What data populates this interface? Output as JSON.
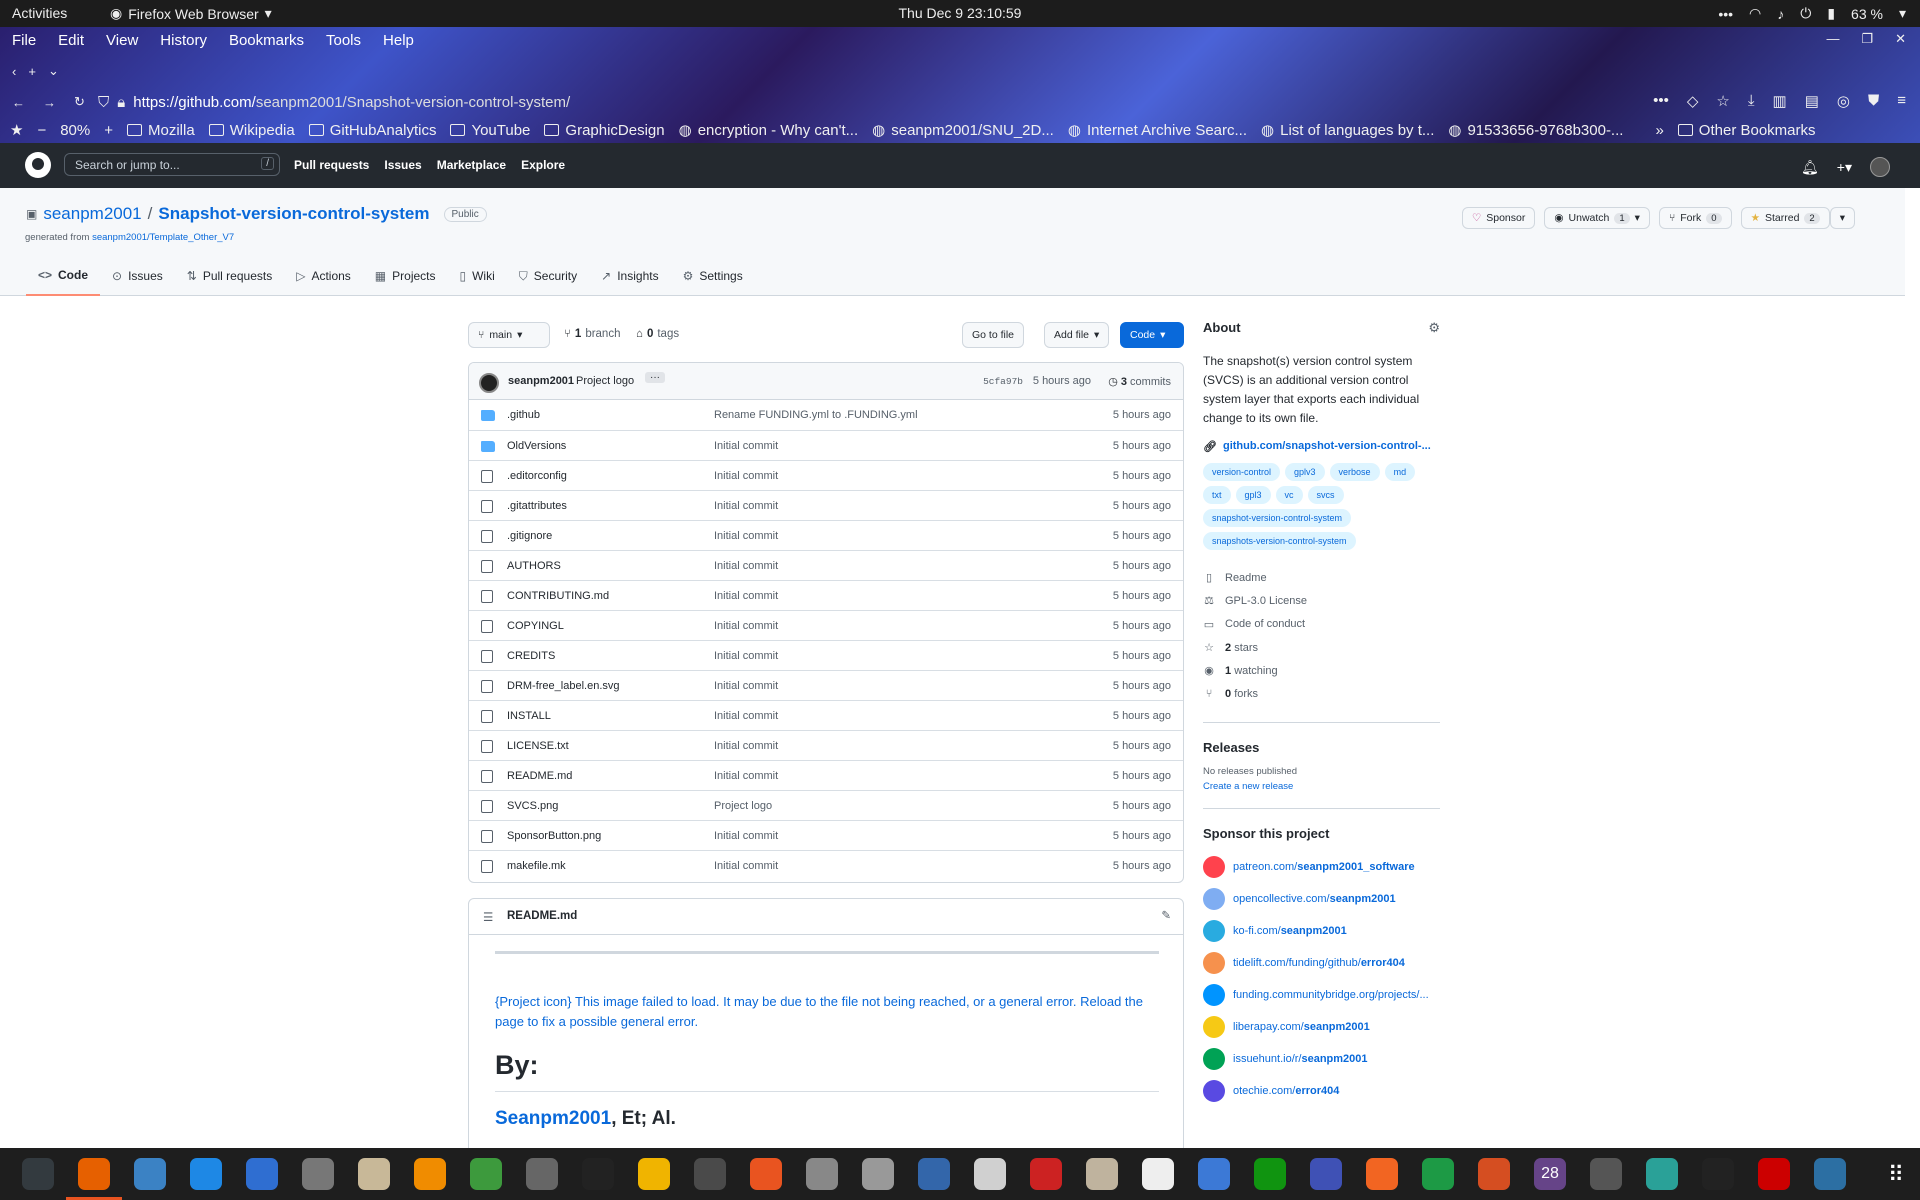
{
  "system": {
    "activities": "Activities",
    "app_name": "Firefox Web Browser",
    "clock": "Thu Dec 9  23:10:59",
    "battery": "63 %"
  },
  "browser": {
    "menu": [
      "File",
      "Edit",
      "View",
      "History",
      "Bookmarks",
      "Tools",
      "Help"
    ],
    "url_host": "https://github.com/",
    "url_path": "seanpm2001/Snapshot-version-control-system/",
    "zoom": "80%",
    "bookmarks": [
      {
        "label": "Mozilla",
        "icon": "folder-icon"
      },
      {
        "label": "Wikipedia",
        "icon": "folder-icon"
      },
      {
        "label": "GitHubAnalytics",
        "icon": "folder-icon"
      },
      {
        "label": "YouTube",
        "icon": "folder-icon"
      },
      {
        "label": "GraphicDesign",
        "icon": "folder-icon"
      },
      {
        "label": "encryption - Why can't...",
        "icon": "stackexchange-icon"
      },
      {
        "label": "seanpm2001/SNU_2D...",
        "icon": "github-icon"
      },
      {
        "label": "Internet Archive Searc...",
        "icon": "archive-icon"
      },
      {
        "label": "List of languages by t...",
        "icon": "wikipedia-icon"
      },
      {
        "label": "91533656-9768b300-...",
        "icon": "globe-icon"
      }
    ],
    "other_bookmarks": "Other Bookmarks"
  },
  "github": {
    "search_placeholder": "Search or jump to...",
    "search_key": "/",
    "nav": [
      "Pull requests",
      "Issues",
      "Marketplace",
      "Explore"
    ]
  },
  "repo": {
    "owner": "seanpm2001",
    "slash": "/",
    "name": "Snapshot-version-control-system",
    "visibility": "Public",
    "generated_prefix": "generated from",
    "template": "seanpm2001/Template_Other_V7",
    "actions": {
      "sponsor": "Sponsor",
      "unwatch": "Unwatch",
      "unwatch_count": "1",
      "fork": "Fork",
      "fork_count": "0",
      "starred": "Starred",
      "star_count": "2"
    },
    "tabs": [
      "Code",
      "Issues",
      "Pull requests",
      "Actions",
      "Projects",
      "Wiki",
      "Security",
      "Insights",
      "Settings"
    ]
  },
  "branch_bar": {
    "branch": "main",
    "branches_count": "1",
    "branches_label": "branch",
    "tags_count": "0",
    "tags_label": "tags",
    "go_to_file": "Go to file",
    "add_file": "Add file",
    "code": "Code"
  },
  "latest_commit": {
    "author": "seanpm2001",
    "message": "Project logo",
    "ellipsis": "···",
    "sha": "5cfa97b",
    "time": "5 hours ago",
    "commits_count": "3",
    "commits_label": "commits"
  },
  "files": [
    {
      "name": ".github",
      "type": "dir",
      "message": "Rename FUNDING.yml to .FUNDING.yml",
      "time": "5 hours ago"
    },
    {
      "name": "OldVersions",
      "type": "dir",
      "message": "Initial commit",
      "time": "5 hours ago"
    },
    {
      "name": ".editorconfig",
      "type": "file",
      "message": "Initial commit",
      "time": "5 hours ago"
    },
    {
      "name": ".gitattributes",
      "type": "file",
      "message": "Initial commit",
      "time": "5 hours ago"
    },
    {
      "name": ".gitignore",
      "type": "file",
      "message": "Initial commit",
      "time": "5 hours ago"
    },
    {
      "name": "AUTHORS",
      "type": "file",
      "message": "Initial commit",
      "time": "5 hours ago"
    },
    {
      "name": "CONTRIBUTING.md",
      "type": "file",
      "message": "Initial commit",
      "time": "5 hours ago"
    },
    {
      "name": "COPYINGL",
      "type": "file",
      "message": "Initial commit",
      "time": "5 hours ago"
    },
    {
      "name": "CREDITS",
      "type": "file",
      "message": "Initial commit",
      "time": "5 hours ago"
    },
    {
      "name": "DRM-free_label.en.svg",
      "type": "file",
      "message": "Initial commit",
      "time": "5 hours ago"
    },
    {
      "name": "INSTALL",
      "type": "file",
      "message": "Initial commit",
      "time": "5 hours ago"
    },
    {
      "name": "LICENSE.txt",
      "type": "file",
      "message": "Initial commit",
      "time": "5 hours ago"
    },
    {
      "name": "README.md",
      "type": "file",
      "message": "Initial commit",
      "time": "5 hours ago"
    },
    {
      "name": "SVCS.png",
      "type": "file",
      "message": "Project logo",
      "time": "5 hours ago"
    },
    {
      "name": "SponsorButton.png",
      "type": "file",
      "message": "Initial commit",
      "time": "5 hours ago"
    },
    {
      "name": "makefile.mk",
      "type": "file",
      "message": "Initial commit",
      "time": "5 hours ago"
    }
  ],
  "readme": {
    "title": "README.md",
    "image_alt": "{Project icon} This image failed to load. It may be due to the file not being reached, or a general error. Reload the page to fix a possible general error.",
    "by_heading": "By:",
    "author_link": "Seanpm2001",
    "author_suffix": ", Et; Al."
  },
  "about": {
    "title": "About",
    "description": "The snapshot(s) version control system (SVCS) is an additional version control system layer that exports each individual change to its own file.",
    "link": "github.com/snapshot-version-control-...",
    "topics": [
      "version-control",
      "gplv3",
      "verbose",
      "md",
      "txt",
      "gpl3",
      "vc",
      "svcs",
      "snapshot-version-control-system",
      "snapshots-version-control-system"
    ],
    "readme": "Readme",
    "license": "GPL-3.0 License",
    "conduct": "Code of conduct",
    "stars_count": "2",
    "stars_label": "stars",
    "watching_count": "1",
    "watching_label": "watching",
    "forks_count": "0",
    "forks_label": "forks"
  },
  "releases": {
    "title": "Releases",
    "none": "No releases published",
    "create": "Create a new release"
  },
  "sponsor": {
    "title": "Sponsor this project",
    "links": [
      {
        "prefix": "patreon.com/",
        "handle": "seanpm2001_software",
        "color": "#ff424d"
      },
      {
        "prefix": "opencollective.com/",
        "handle": "seanpm2001",
        "color": "#7fadf2"
      },
      {
        "prefix": "ko-fi.com/",
        "handle": "seanpm2001",
        "color": "#29abe0"
      },
      {
        "prefix": "tidelift.com/funding/github/",
        "handle": "error404",
        "color": "#f6914d"
      },
      {
        "prefix": "funding.communitybridge.org/projects/...",
        "handle": "",
        "color": "#0094ff"
      },
      {
        "prefix": "liberapay.com/",
        "handle": "seanpm2001",
        "color": "#f6c915"
      },
      {
        "prefix": "issuehunt.io/r/",
        "handle": "seanpm2001",
        "color": "#00a255"
      },
      {
        "prefix": "otechie.com/",
        "handle": "error404",
        "color": "#594ae2"
      }
    ]
  },
  "dock": {
    "calendar_day": "28",
    "colors": [
      "#333a3f",
      "#e66000",
      "#3b82c4",
      "#1e88e5",
      "#2f6ed1",
      "#777777",
      "#c8b898",
      "#f08c00",
      "#3d9a3d",
      "#666666",
      "#222222",
      "#f0b400",
      "#4a4a4a",
      "#e95420",
      "#888888",
      "#999999",
      "#3366aa",
      "#d0d0d0",
      "#cc2222",
      "#bfb39e",
      "#eeeeee",
      "#3c79d6",
      "#109410",
      "#3f51b5",
      "#f26522",
      "#1d9a45",
      "#d54e21",
      "#664488",
      "#555555",
      "#2aa198",
      "#222222",
      "#cc0000",
      "#2c6fa3"
    ]
  }
}
